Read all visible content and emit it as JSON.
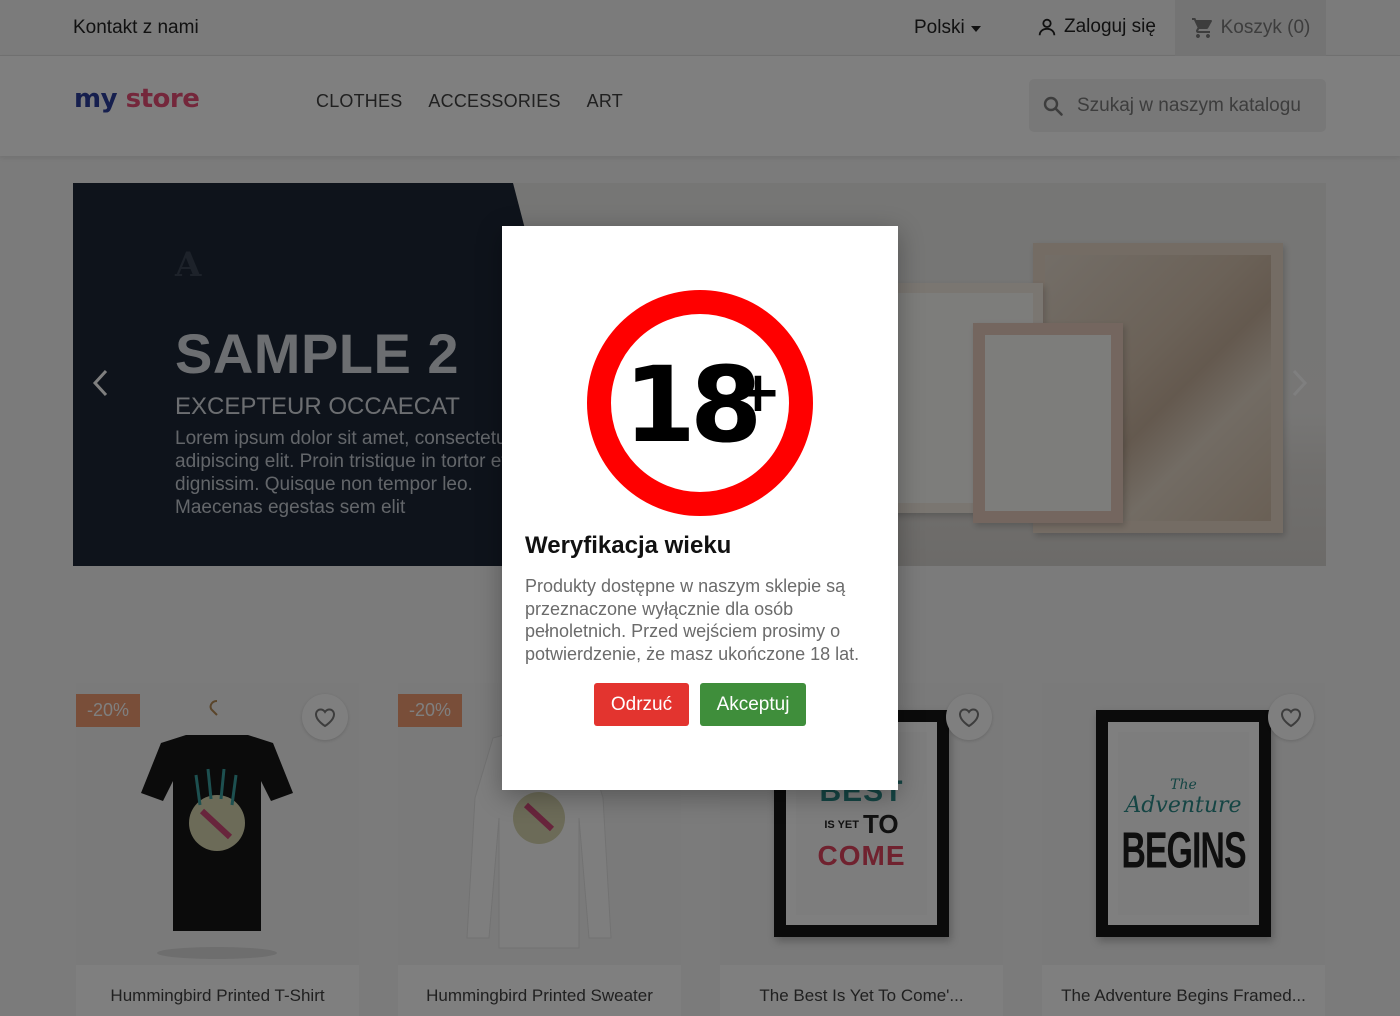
{
  "topbar": {
    "contact": "Kontakt z nami",
    "language": "Polski",
    "login": "Zaloguj się",
    "cart": "Koszyk (0)"
  },
  "header": {
    "logo": {
      "part1": "my",
      "part2": "store"
    },
    "nav": [
      "CLOTHES",
      "ACCESSORIES",
      "ART"
    ],
    "search_placeholder": "Szukaj w naszym katalogu"
  },
  "slider": {
    "title": "SAMPLE 2",
    "subtitle": "EXCEPTEUR OCCAECAT",
    "text": "Lorem ipsum dolor sit amet, consectetur adipiscing elit. Proin tristique in tortor et dignissim. Quisque non tempor leo. Maecenas egestas sem elit"
  },
  "products": [
    {
      "name": "Hummingbird Printed T-Shirt",
      "badge": "-20%"
    },
    {
      "name": "Hummingbird Printed Sweater",
      "badge": "-20%"
    },
    {
      "name": "The Best Is Yet To Come'...",
      "badge": ""
    },
    {
      "name": "The Adventure Begins Framed...",
      "badge": ""
    }
  ],
  "posters": {
    "p3": {
      "line1": "BEST",
      "line2a": "IS YET",
      "line2b": "TO",
      "line3": "COME"
    },
    "p4": {
      "line1": "The",
      "line2": "Adventure",
      "line3": "BEGINS"
    }
  },
  "modal": {
    "sign_text": "18",
    "sign_plus": "+",
    "title": "Weryfikacja wieku",
    "text": "Produkty dostępne w naszym sklepie są przeznaczone wyłącznie dla osób pełnoletnich. Przed wejściem prosimy o potwierdzenie, że masz ukończone 18 lat.",
    "reject": "Odrzuć",
    "accept": "Akceptuj"
  },
  "colors": {
    "overlay": "rgba(0,0,0,0.5)",
    "reject": "#e3342f",
    "accept": "#3f8e3b",
    "sign_ring": "#ff0000",
    "badge": "#f39d72"
  }
}
